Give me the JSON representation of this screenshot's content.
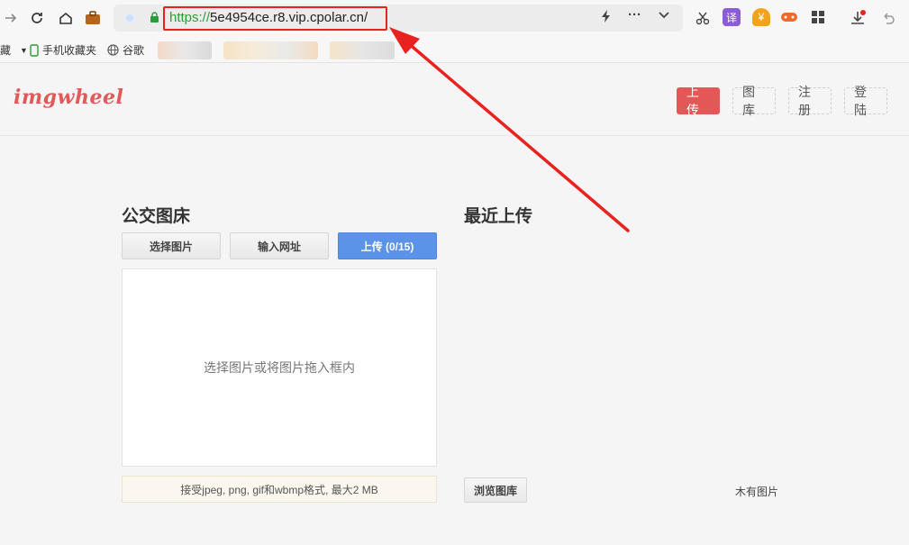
{
  "browser": {
    "url_protocol": "https://",
    "url_rest": "5e4954ce.r8.vip.cpolar.cn/",
    "bookmarks": {
      "cut_label": "藏",
      "mobile_label": "手机收藏夹",
      "google_label": "谷歌"
    },
    "ext_translate_label": "译"
  },
  "site": {
    "logo": "imgwheel",
    "nav": {
      "upload": "上传",
      "gallery": "图库",
      "register": "注册",
      "login": "登陆"
    }
  },
  "left": {
    "title": "公交图床",
    "select_button": "选择图片",
    "url_button": "输入网址",
    "upload_button": "上传 (0/15)",
    "dropzone_text": "选择图片或将图片拖入框内",
    "hint": "接受jpeg, png, gif和wbmp格式, 最大2 MB"
  },
  "right": {
    "title": "最近上传",
    "browse_button": "浏览图库",
    "empty_text": "木有图片"
  },
  "colors": {
    "primary_red": "#e45757",
    "upload_blue": "#5b93e8",
    "annotation_red": "#e8221f"
  }
}
